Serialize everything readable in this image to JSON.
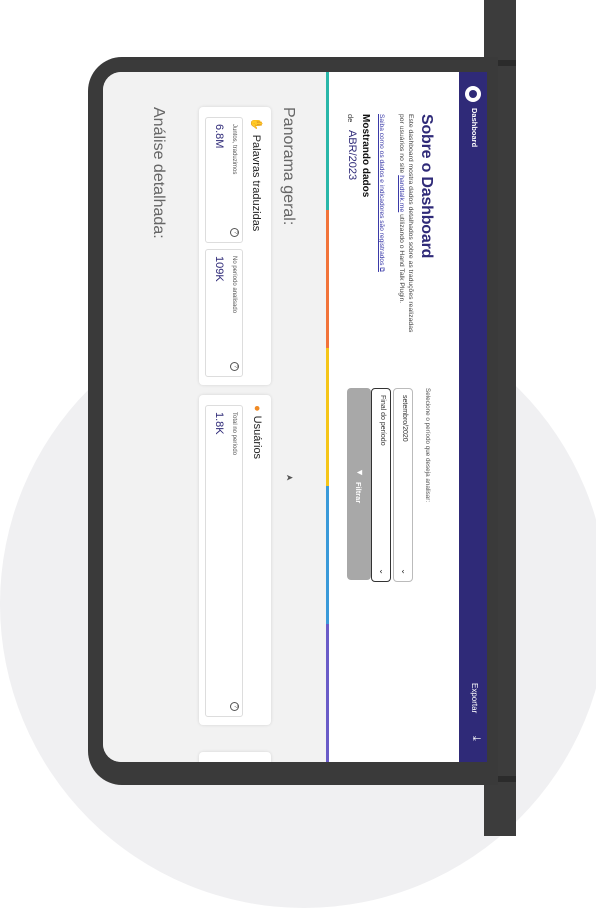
{
  "nav": {
    "title": "Dashboard",
    "export_label": "Exportar",
    "export_icon": "⤓"
  },
  "about": {
    "title": "Sobre o Dashboard",
    "desc_1": "Este dashboard mostra dados detalhados sobre as traduções realizadas por usuários no site ",
    "link_1": "handtalk.me",
    "desc_2": " utilizando o Hand Talk Plugin.",
    "know_more": "Saiba como os dados e indicadores são registrados ⧉",
    "showing": "Mostrando dados",
    "de": "de",
    "period": "ABR/2023"
  },
  "filter": {
    "prompt": "Selecione o período que deseja analisar:",
    "start_value": "setembro/2020",
    "end_placeholder": "Final do período",
    "button_label": "Filtrar",
    "button_icon": "▼"
  },
  "stripes": [
    "#2ab7a9",
    "#f2743a",
    "#f5c518",
    "#3a9ad9",
    "#6a5cc8"
  ],
  "overview": {
    "title": "Panorama geral:",
    "words": {
      "title": "Palavras traduzidas",
      "total_label": "Juntos, traduzimos",
      "total_value": "6.8M",
      "period_label": "No período analisado",
      "period_value": "109K"
    },
    "users": {
      "title": "Usuários",
      "total_label": "Total no período",
      "total_value": "1.8K"
    }
  },
  "detail": {
    "title": "Análise detalhada:"
  }
}
